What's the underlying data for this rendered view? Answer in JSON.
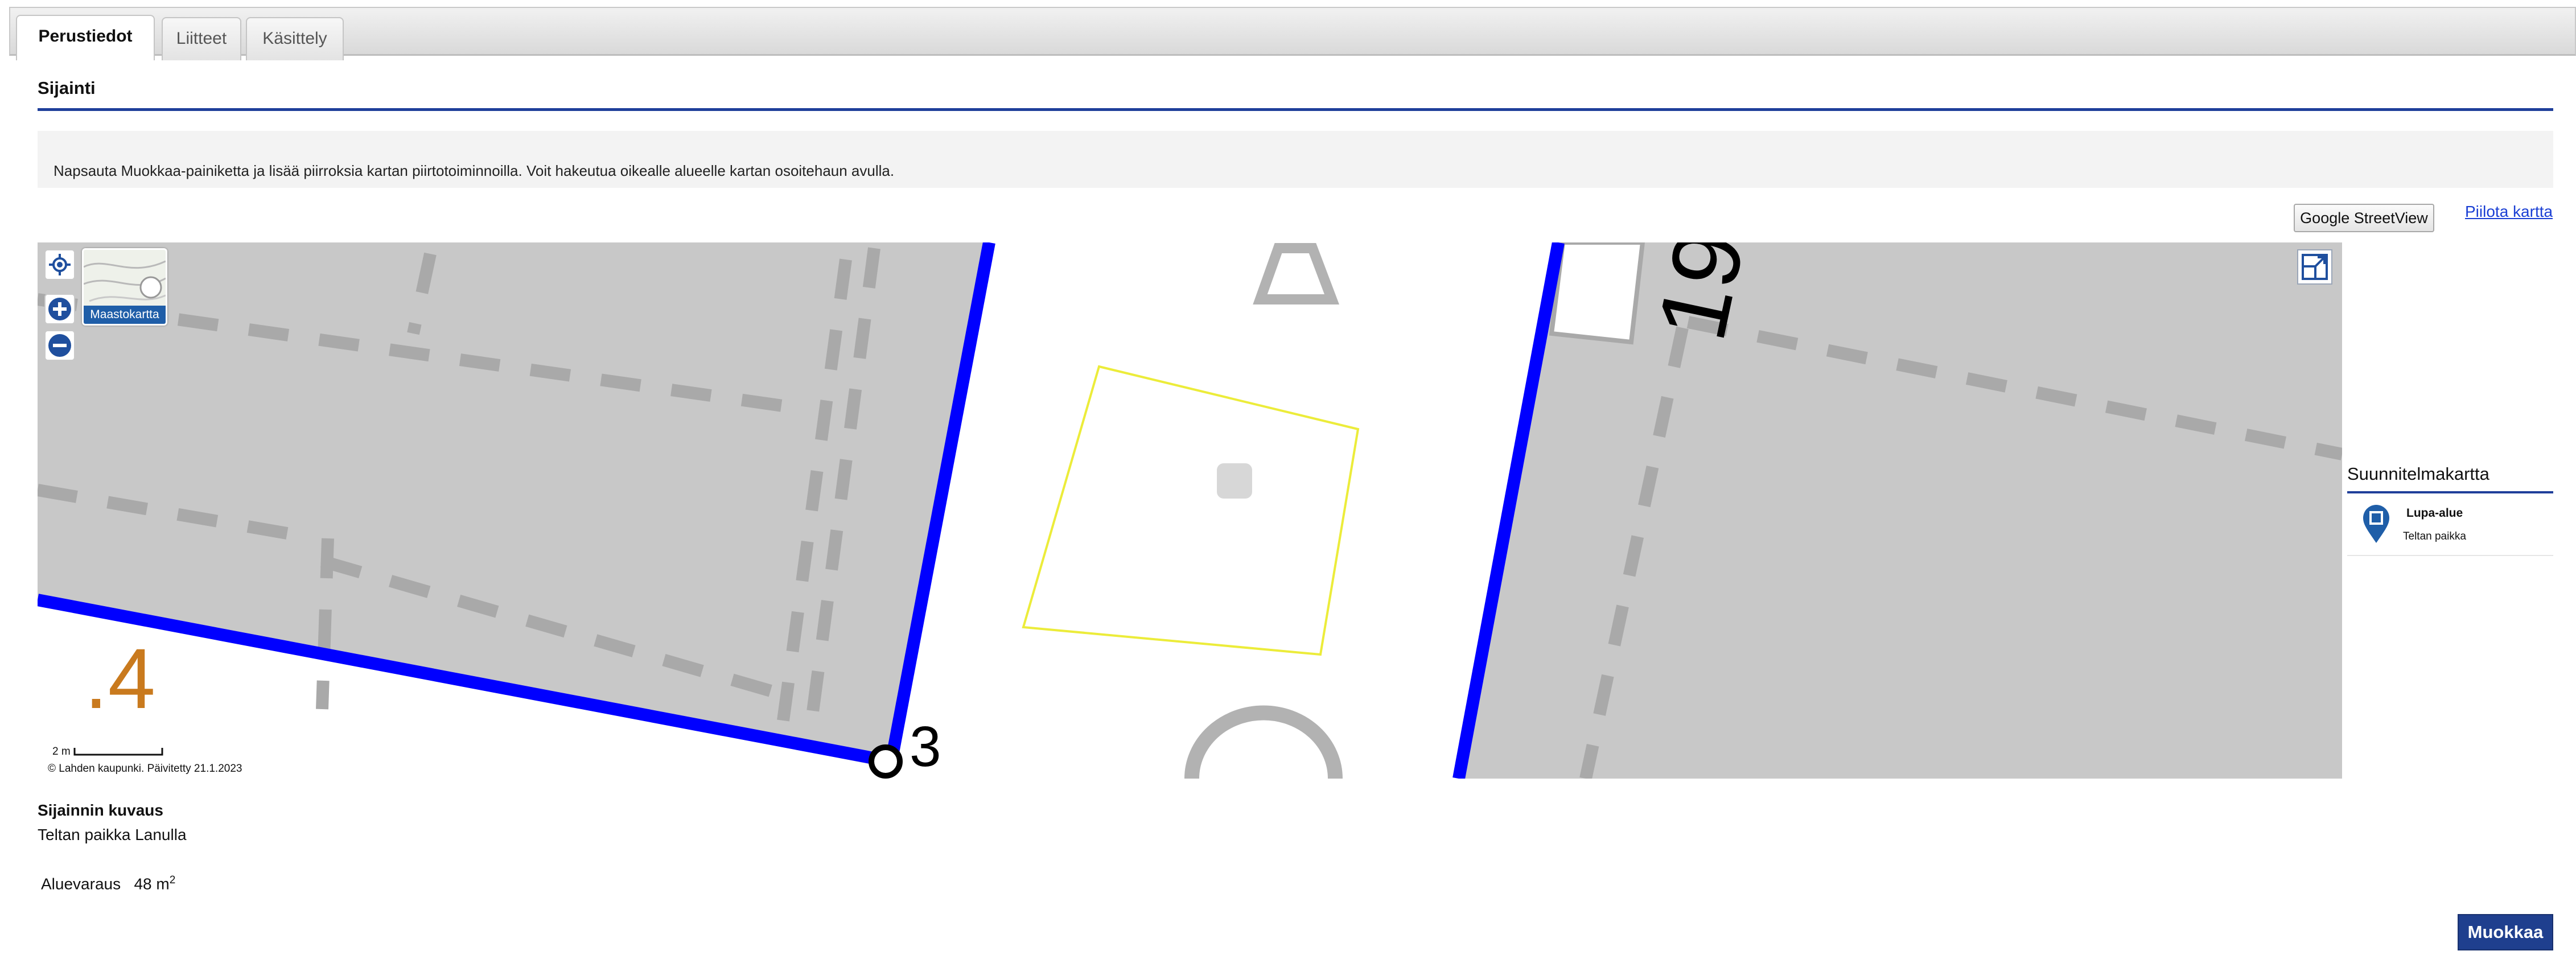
{
  "tabs": [
    {
      "label": "Perustiedot",
      "active": true
    },
    {
      "label": "Liitteet",
      "active": false
    },
    {
      "label": "Käsittely",
      "active": false
    }
  ],
  "section": {
    "title": "Sijainti"
  },
  "info_text": "Napsauta Muokkaa-painiketta ja lisää piirroksia kartan piirtotoiminnoilla. Voit hakeutua oikealle alueelle kartan osoitehaun avulla.",
  "map": {
    "streetview_label": "Google StreetView",
    "hide_map_label": "Piilota kartta",
    "base_layer_label": "Maastokartta",
    "scale_label": "2 m",
    "attribution": "© Lahden kaupunki. Päivitetty 21.1.2023",
    "map_text_fragment": ".4",
    "map_text_number": "3",
    "map_text_rotated": "19",
    "colors": {
      "parcel_fill": "#c8c8c8",
      "boundary": "#0000ff",
      "drawn_area": "#ecec3a",
      "map_label": "#c97a1e"
    }
  },
  "legend": {
    "title": "Suunnitelmakartta",
    "item_title": "Lupa-alue",
    "item_subtitle": "Teltan paikka",
    "icon": "map-pin-icon"
  },
  "location_description": {
    "label": "Sijainnin kuvaus",
    "value": "Teltan paikka Lanulla"
  },
  "area_reservation": {
    "label": "Aluevaraus",
    "value": "48",
    "unit": "m",
    "unit_exponent": "2"
  },
  "edit_button_label": "Muokkaa"
}
